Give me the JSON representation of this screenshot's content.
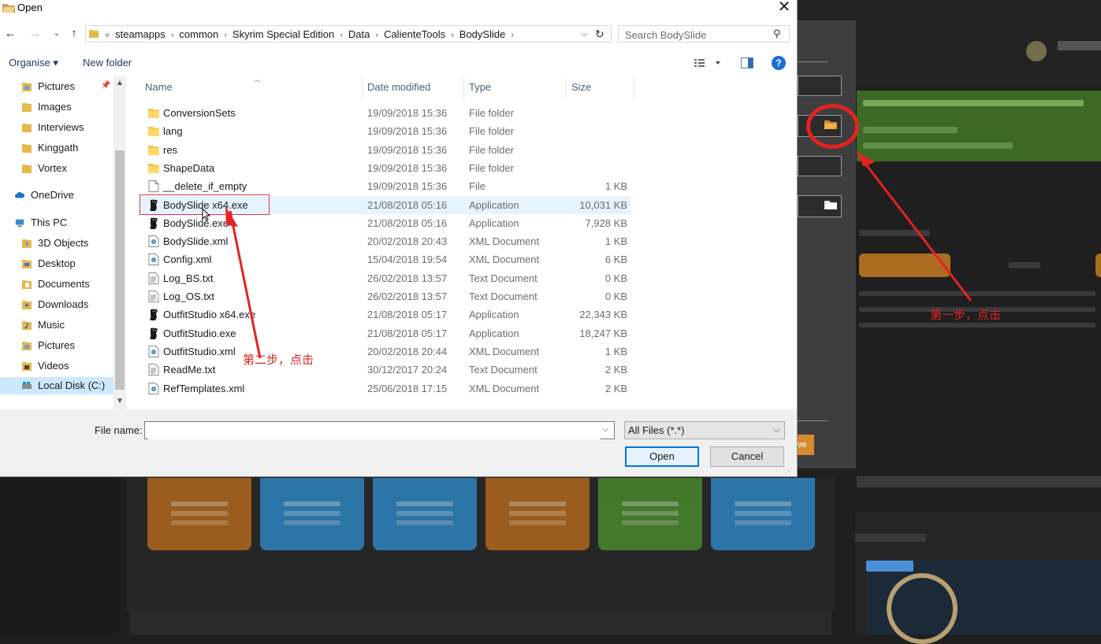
{
  "dialog": {
    "title": "Open",
    "breadcrumb": [
      "steamapps",
      "common",
      "Skyrim Special Edition",
      "Data",
      "CalienteTools",
      "BodySlide"
    ],
    "breadcrumb_lead": "«",
    "search_placeholder": "Search BodySlide",
    "toolbar": {
      "organise": "Organise ▾",
      "new_folder": "New folder"
    },
    "help": "?",
    "nav": {
      "quick": [
        "Pictures",
        "Images",
        "Interviews",
        "Kinggath",
        "Vortex"
      ],
      "onedrive": "OneDrive",
      "thispc": "This PC",
      "pc_items": [
        "3D Objects",
        "Desktop",
        "Documents",
        "Downloads",
        "Music",
        "Pictures",
        "Videos",
        "Local Disk (C:)"
      ]
    },
    "columns": {
      "name": "Name",
      "date": "Date modified",
      "type": "Type",
      "size": "Size"
    },
    "files": [
      {
        "name": "ConversionSets",
        "date": "19/09/2018 15:36",
        "type": "File folder",
        "size": "",
        "icon": "folder"
      },
      {
        "name": "lang",
        "date": "19/09/2018 15:36",
        "type": "File folder",
        "size": "",
        "icon": "folder"
      },
      {
        "name": "res",
        "date": "19/09/2018 15:36",
        "type": "File folder",
        "size": "",
        "icon": "folder"
      },
      {
        "name": "ShapeData",
        "date": "19/09/2018 15:36",
        "type": "File folder",
        "size": "",
        "icon": "folder"
      },
      {
        "name": "__delete_if_empty",
        "date": "19/09/2018 15:36",
        "type": "File",
        "size": "1 KB",
        "icon": "file"
      },
      {
        "name": "BodySlide x64.exe",
        "date": "21/08/2018 05:16",
        "type": "Application",
        "size": "10,031 KB",
        "icon": "app"
      },
      {
        "name": "BodySlide.exe",
        "date": "21/08/2018 05:16",
        "type": "Application",
        "size": "7,928 KB",
        "icon": "app"
      },
      {
        "name": "BodySlide.xml",
        "date": "20/02/2018 20:43",
        "type": "XML Document",
        "size": "1 KB",
        "icon": "xml"
      },
      {
        "name": "Config.xml",
        "date": "15/04/2018 19:54",
        "type": "XML Document",
        "size": "6 KB",
        "icon": "xml"
      },
      {
        "name": "Log_BS.txt",
        "date": "26/02/2018 13:57",
        "type": "Text Document",
        "size": "0 KB",
        "icon": "txt"
      },
      {
        "name": "Log_OS.txt",
        "date": "26/02/2018 13:57",
        "type": "Text Document",
        "size": "0 KB",
        "icon": "txt"
      },
      {
        "name": "OutfitStudio x64.exe",
        "date": "21/08/2018 05:17",
        "type": "Application",
        "size": "22,343 KB",
        "icon": "app"
      },
      {
        "name": "OutfitStudio.exe",
        "date": "21/08/2018 05:17",
        "type": "Application",
        "size": "18,247 KB",
        "icon": "app"
      },
      {
        "name": "OutfitStudio.xml",
        "date": "20/02/2018 20:44",
        "type": "XML Document",
        "size": "1 KB",
        "icon": "xml"
      },
      {
        "name": "ReadMe.txt",
        "date": "30/12/2017 20:24",
        "type": "Text Document",
        "size": "2 KB",
        "icon": "txt"
      },
      {
        "name": "RefTemplates.xml",
        "date": "25/06/2018 17:15",
        "type": "XML Document",
        "size": "2 KB",
        "icon": "xml"
      }
    ],
    "filename_label": "File name:",
    "filename_value": "",
    "filetype": "All Files (*.*)",
    "open_button": "Open",
    "cancel_button": "Cancel"
  },
  "background": {
    "save_button_fragment": "ve"
  },
  "annotations": {
    "step1": "第一步，点击",
    "step2": "第二步，点击",
    "color": "#e52222"
  }
}
